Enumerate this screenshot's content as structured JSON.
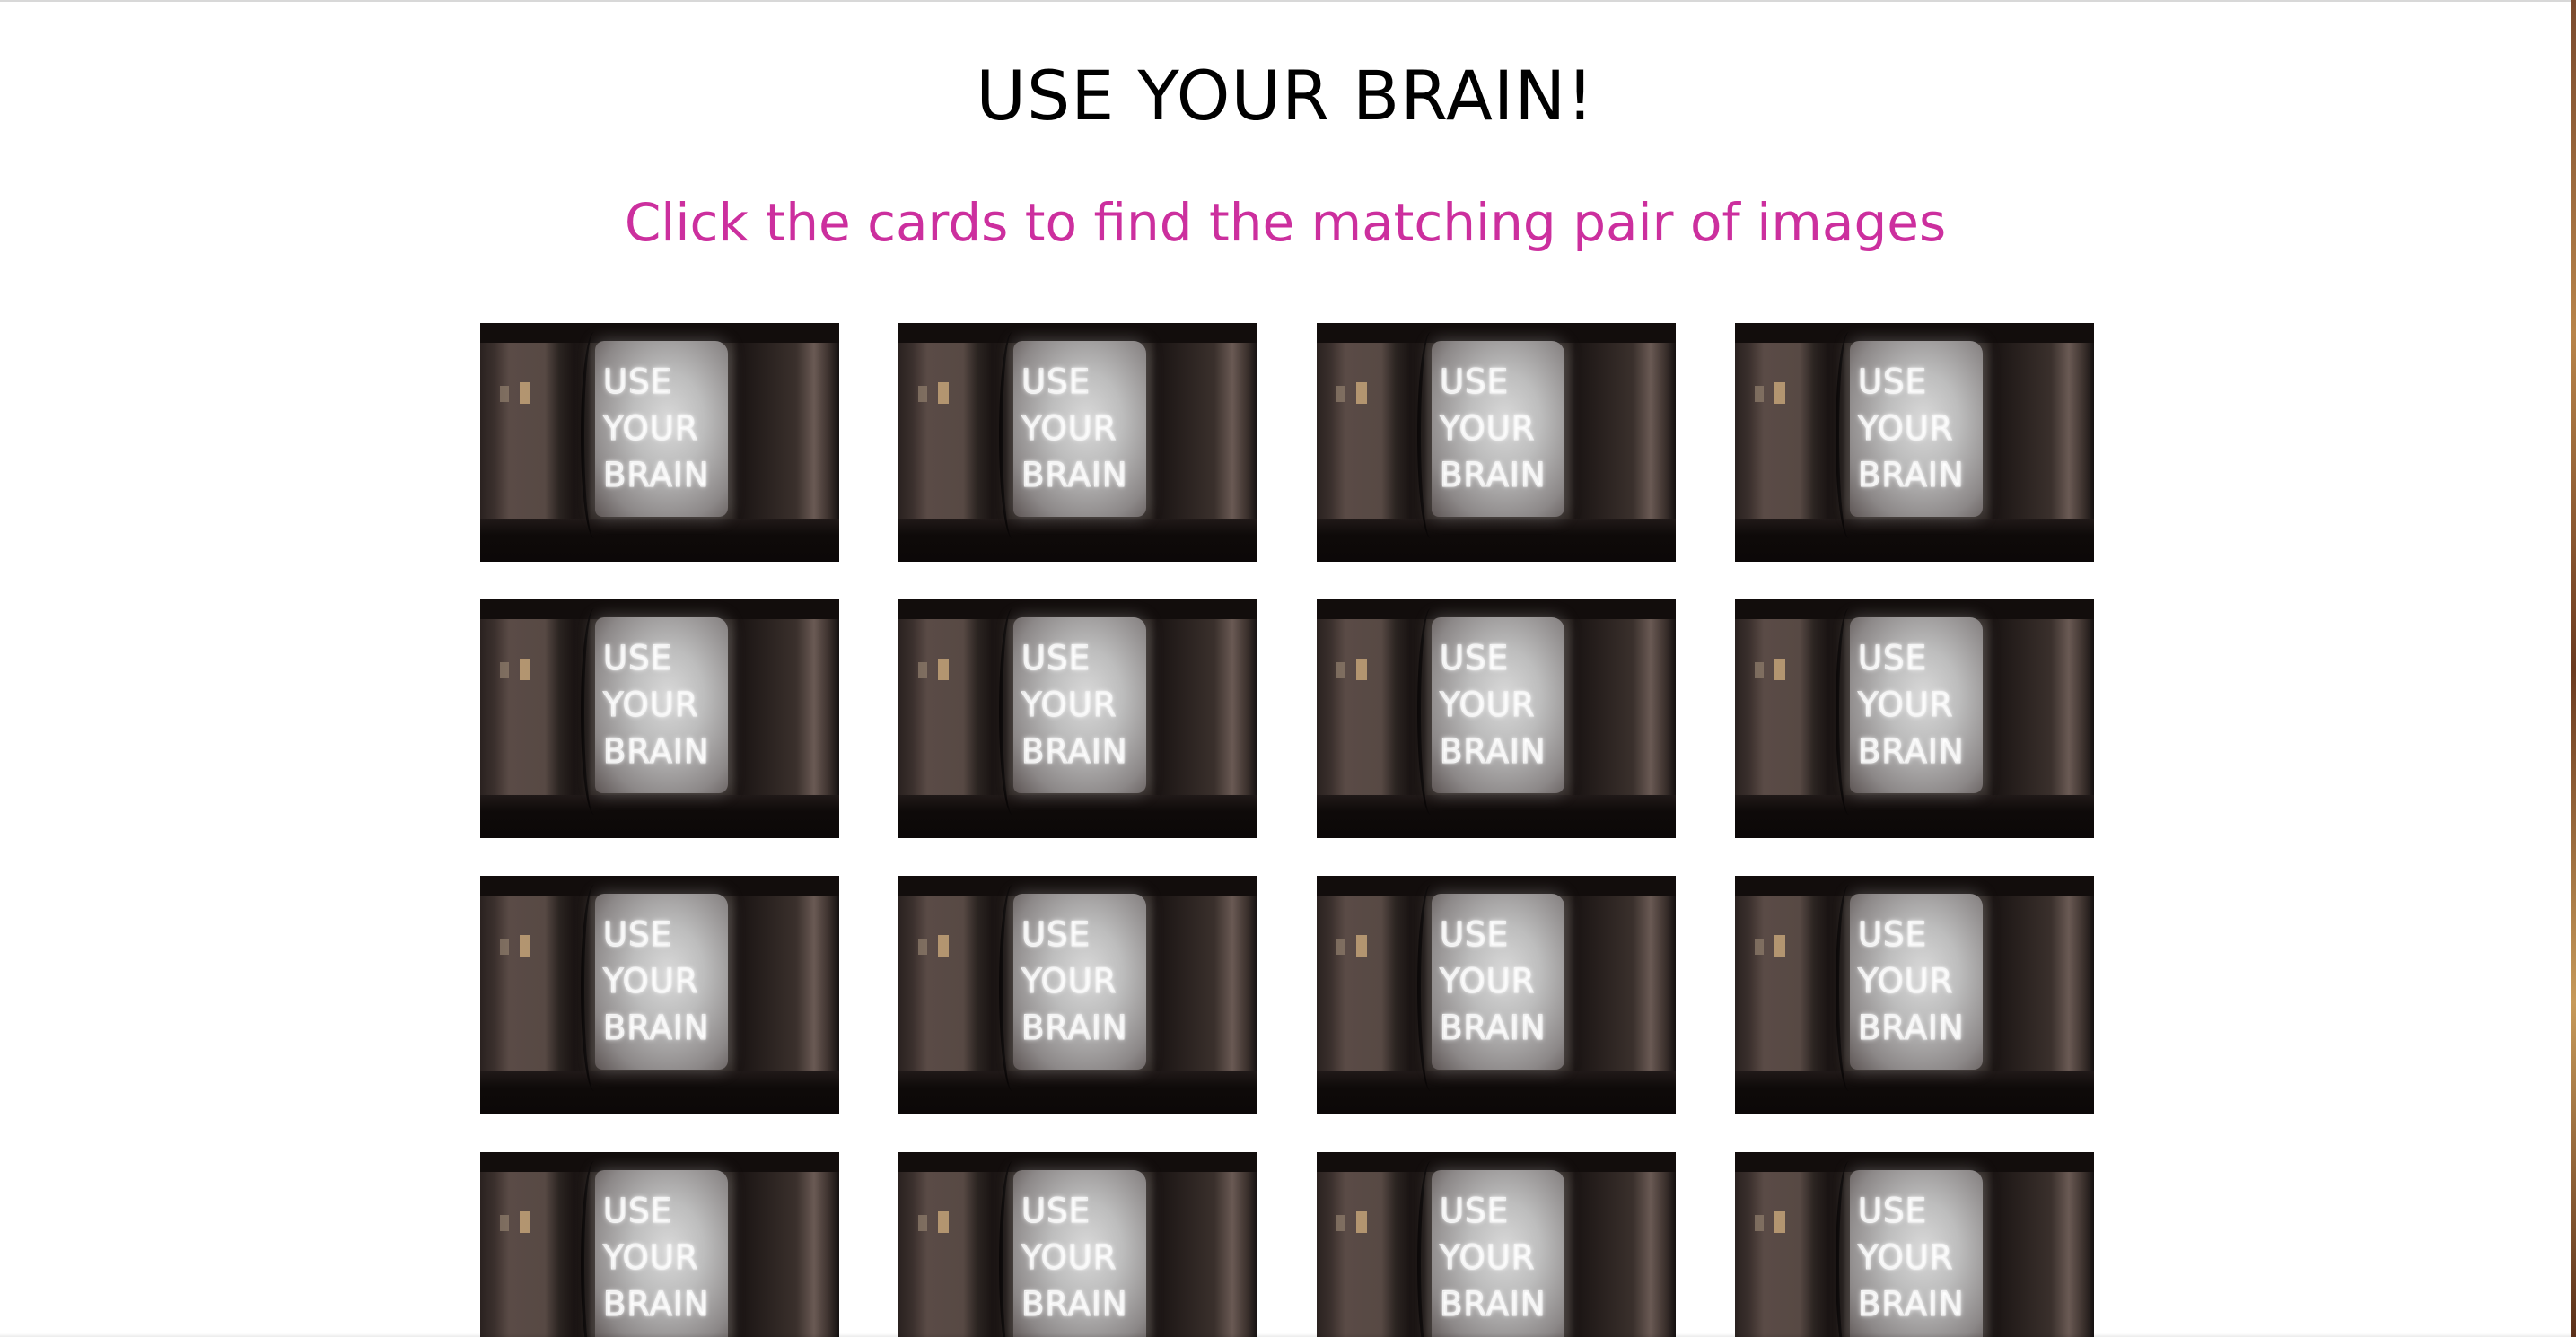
{
  "header": {
    "title": "USE YOUR BRAIN!",
    "subtitle": "Click the cards to find the matching pair of images"
  },
  "colors": {
    "title": "#000000",
    "subtitle": "#cc2f9e",
    "background": "#ffffff"
  },
  "board": {
    "columns": 4,
    "visible_rows": 4,
    "card_back": {
      "image": "neon-sign-icon",
      "lines": [
        "USE",
        "YOUR",
        "BRAIN"
      ]
    },
    "cards": [
      {
        "state": "face-down"
      },
      {
        "state": "face-down"
      },
      {
        "state": "face-down"
      },
      {
        "state": "face-down"
      },
      {
        "state": "face-down"
      },
      {
        "state": "face-down"
      },
      {
        "state": "face-down"
      },
      {
        "state": "face-down"
      },
      {
        "state": "face-down"
      },
      {
        "state": "face-down"
      },
      {
        "state": "face-down"
      },
      {
        "state": "face-down"
      },
      {
        "state": "face-down"
      },
      {
        "state": "face-down"
      },
      {
        "state": "face-down"
      },
      {
        "state": "face-down"
      }
    ]
  }
}
